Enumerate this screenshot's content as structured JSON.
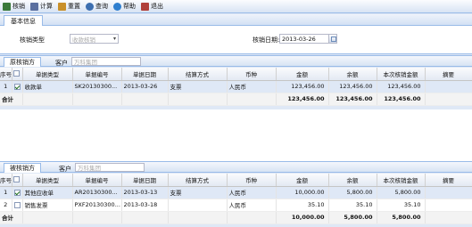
{
  "toolbar": {
    "buttons": [
      {
        "label": "核销",
        "icon": "check-icon",
        "color": "#3b7a3b"
      },
      {
        "label": "计算",
        "icon": "calculator-icon",
        "color": "#5a6fa0"
      },
      {
        "label": "重置",
        "icon": "refresh-icon",
        "color": "#c9902a"
      },
      {
        "label": "查询",
        "icon": "search-icon",
        "color": "#3d6fb0"
      },
      {
        "label": "帮助",
        "icon": "help-icon",
        "color": "#2f7fcf"
      },
      {
        "label": "退出",
        "icon": "exit-icon",
        "color": "#b0403a"
      }
    ]
  },
  "basic": {
    "tab": "基本信息",
    "type_label": "核销类型",
    "type_placeholder": "收款核销",
    "date_label": "核销日期:",
    "date_value": "2013-03-26"
  },
  "upper": {
    "tab": "原核销方",
    "customer_label": "客户",
    "customer_placeholder": "万科集团",
    "headers": [
      "序号",
      "",
      "单据类型",
      "单据编号",
      "单据日期",
      "结算方式",
      "币种",
      "金额",
      "余额",
      "本次核销金额",
      "摘要"
    ],
    "rows": [
      {
        "no": "1",
        "checked": true,
        "type": "收款单",
        "code": "SK20130300...",
        "date": "2013-03-26",
        "settle": "支票",
        "currency": "人民币",
        "amount": "123,456.00",
        "balance": "123,456.00",
        "this": "123,456.00",
        "memo": ""
      }
    ],
    "total_label": "合计",
    "total_amount": "123,456.00",
    "total_balance": "123,456.00",
    "total_this": "123,456.00"
  },
  "lower": {
    "tab": "被核销方",
    "customer_label": "客户",
    "customer_placeholder": "万科集团",
    "headers": [
      "序号",
      "",
      "单据类型",
      "单据编号",
      "单据日期",
      "结算方式",
      "币种",
      "金额",
      "余额",
      "本次核销金额",
      "摘要"
    ],
    "rows": [
      {
        "no": "1",
        "checked": true,
        "type": "其他应收单",
        "code": "AR20130300...",
        "date": "2013-03-13",
        "settle": "支票",
        "currency": "人民币",
        "amount": "10,000.00",
        "balance": "5,800.00",
        "this": "5,800.00",
        "memo": ""
      },
      {
        "no": "2",
        "checked": false,
        "type": "销售发票",
        "code": "PXF20130300...",
        "date": "2013-03-18",
        "settle": "",
        "currency": "人民币",
        "amount": "35.10",
        "balance": "35.10",
        "this": "35.10",
        "memo": ""
      }
    ],
    "total_label": "合计",
    "total_amount": "10,000.00",
    "total_balance": "5,800.00",
    "total_this": "5,800.00"
  }
}
